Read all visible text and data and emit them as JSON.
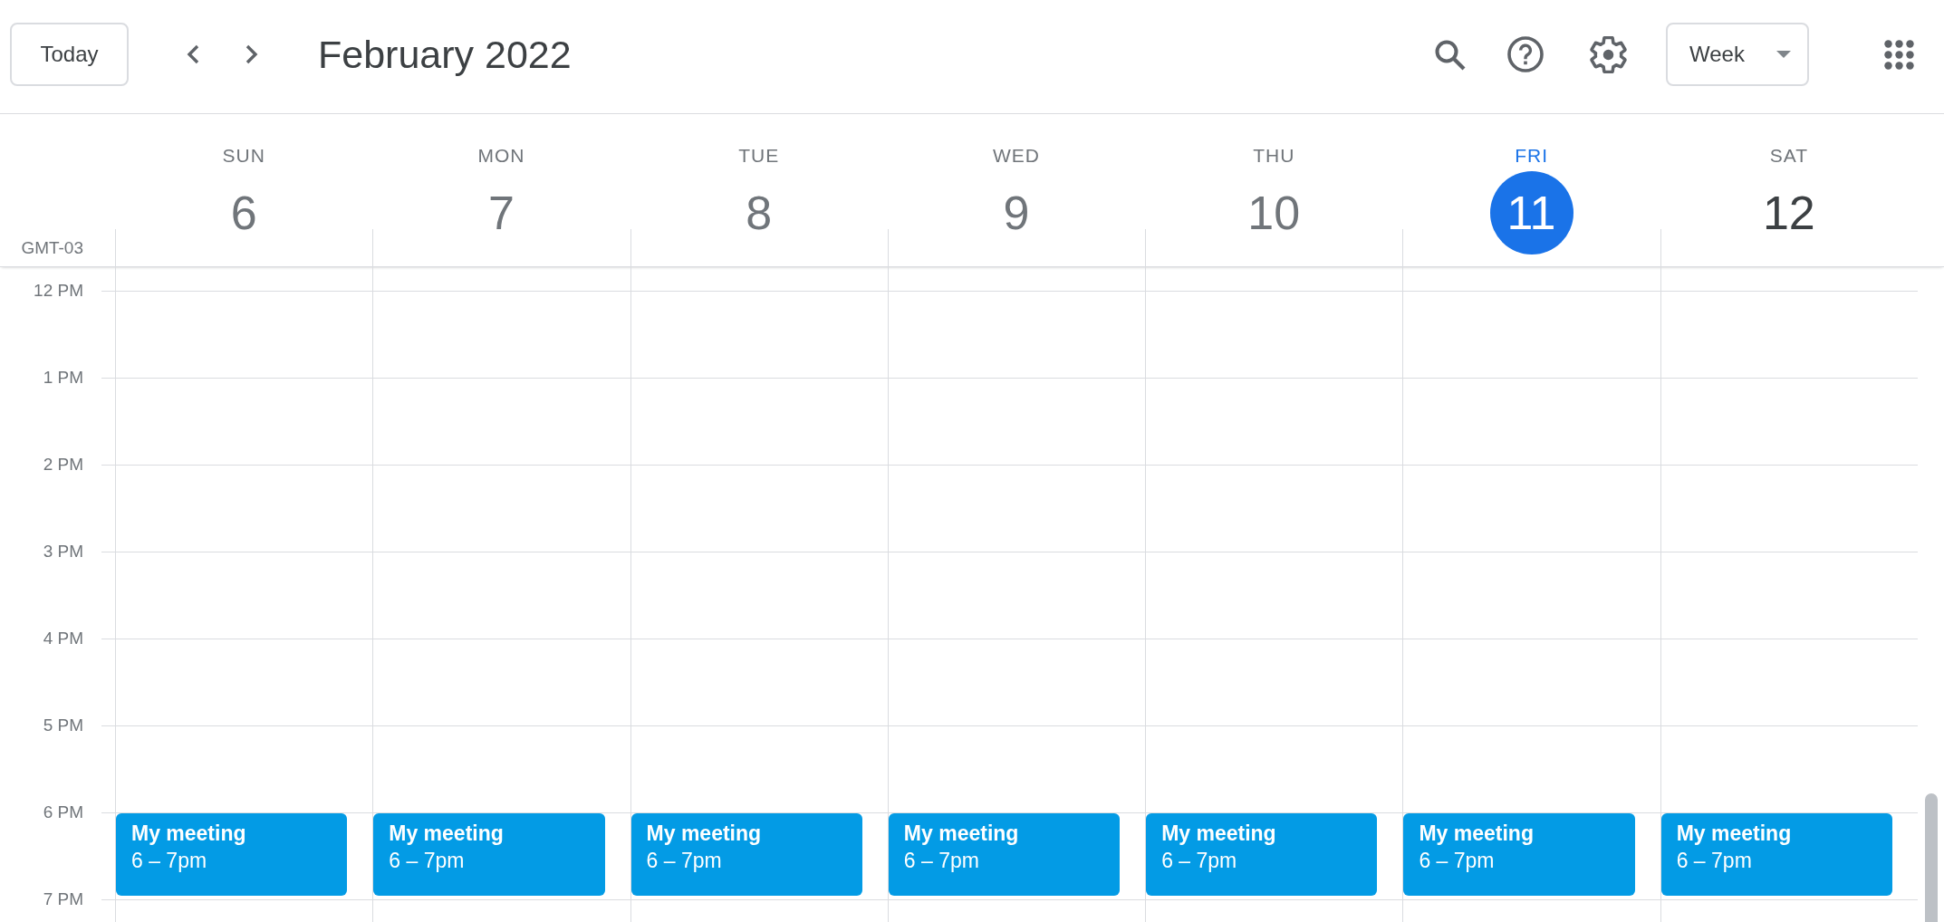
{
  "toolbar": {
    "today_button": "Today",
    "title": "February 2022",
    "view_dropdown": "Week"
  },
  "timezone": "GMT-03",
  "days": [
    {
      "name": "SUN",
      "date": "6",
      "selected": false,
      "past": true
    },
    {
      "name": "MON",
      "date": "7",
      "selected": false,
      "past": true
    },
    {
      "name": "TUE",
      "date": "8",
      "selected": false,
      "past": true
    },
    {
      "name": "WED",
      "date": "9",
      "selected": false,
      "past": true
    },
    {
      "name": "THU",
      "date": "10",
      "selected": false,
      "past": true
    },
    {
      "name": "FRI",
      "date": "11",
      "selected": true,
      "past": false
    },
    {
      "name": "SAT",
      "date": "12",
      "selected": false,
      "past": false
    }
  ],
  "hours": [
    {
      "label": "12 PM"
    },
    {
      "label": "1 PM"
    },
    {
      "label": "2 PM"
    },
    {
      "label": "3 PM"
    },
    {
      "label": "4 PM"
    },
    {
      "label": "5 PM"
    },
    {
      "label": "6 PM",
      "events": [
        {
          "title": "My meeting",
          "time": "6 – 7pm"
        },
        {
          "title": "My meeting",
          "time": "6 – 7pm"
        },
        {
          "title": "My meeting",
          "time": "6 – 7pm"
        },
        {
          "title": "My meeting",
          "time": "6 – 7pm"
        },
        {
          "title": "My meeting",
          "time": "6 – 7pm"
        },
        {
          "title": "My meeting",
          "time": "6 – 7pm"
        },
        {
          "title": "My meeting",
          "time": "6 – 7pm"
        }
      ]
    },
    {
      "label": "7 PM"
    }
  ]
}
